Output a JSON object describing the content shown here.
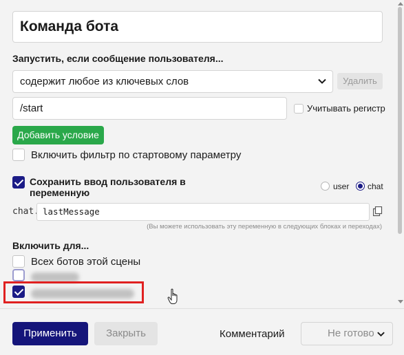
{
  "command": {
    "title": "Команда бота"
  },
  "trigger": {
    "section_label": "Запустить, если сообщение пользователя...",
    "condition_select": "содержит любое из ключевых слов",
    "delete_label": "Удалить",
    "keyword_value": "/start",
    "case_sensitive_label": "Учитывать регистр",
    "case_sensitive_checked": false,
    "add_condition_label": "Добавить условие",
    "start_param_filter_label": "Включить фильтр по стартовому параметру",
    "start_param_filter_checked": false
  },
  "save_input": {
    "label": "Сохранить ввод пользователя в переменную",
    "checked": true,
    "scope_options": [
      "user",
      "chat"
    ],
    "scope_selected": "chat",
    "prefix": "chat.",
    "variable_name": "lastMessage",
    "hint": "(Вы можете использовать эту переменную в следующих блоках и переходах)"
  },
  "enable_for": {
    "section_label": "Включить для...",
    "all_bots_label": "Всех ботов этой сцены",
    "all_bots_checked": false
  },
  "footer": {
    "apply_label": "Применить",
    "close_label": "Закрыть",
    "comment_label": "Комментарий",
    "status_value": "Не готово"
  },
  "colors": {
    "primary": "#15157a",
    "success": "#2aa84a",
    "highlight": "#e02020"
  }
}
